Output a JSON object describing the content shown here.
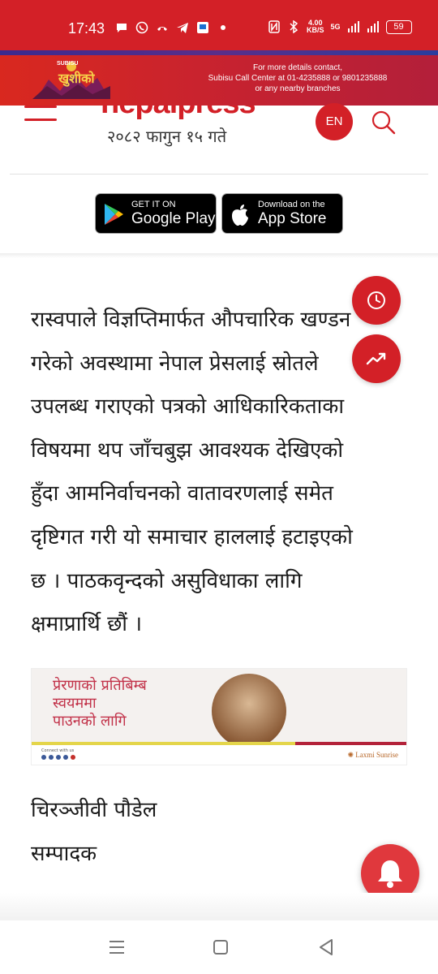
{
  "status_bar": {
    "time": "17:43",
    "net_speed": "4.00",
    "net_unit": "KB/S",
    "network_type": "5G",
    "battery": "59"
  },
  "top_ad": {
    "logo_text": "खुशीको",
    "logo_brand": "SUBISU",
    "line1": "For more details contact,",
    "line2": "Subisu Call Center at 01-4235888 or 9801235888",
    "line3": "or any nearby branches"
  },
  "header": {
    "site_logo": "nepalpress",
    "date": "२०८२ फागुन १५ गते",
    "lang_button": "EN"
  },
  "app_badges": {
    "google_small": "GET IT ON",
    "google_big": "Google Play",
    "apple_small": "Download on the",
    "apple_big": "App Store"
  },
  "article": {
    "lines": [
      "रास्वपाले विज्ञप्तिमार्फत औपचारिक खण्डन",
      "गरेको अवस्थामा नेपाल प्रेसलाई स्रोतले",
      "उपलब्ध गराएको पत्रको आधिकारिकताका",
      "विषयमा थप जाँचबुझ आवश्यक देखिएको",
      "हुँदा आमनिर्वाचनको वातावरणलाई समेत",
      "दृष्टिगत गरी यो समाचार हाललाई हटाइएको",
      "छ । पाठकवृन्दको असुविधाका लागि",
      "क्षमाप्रार्थि छौं ।"
    ]
  },
  "mid_ad": {
    "line1": "प्रेरणाको प्रतिबिम्ब",
    "line2": "स्वयममा",
    "line3": "पाउनको लागि",
    "contact": "Connect with us",
    "brand": "Laxmi Sunrise"
  },
  "signature": {
    "name": "चिरञ्जीवी पौडेल",
    "title": "सम्पादक"
  },
  "colors": {
    "brand_red": "#d32027",
    "bell_red": "#e0383d"
  },
  "icons": {
    "menu": "hamburger-icon",
    "search": "search-icon",
    "history": "clock-icon",
    "trending": "trending-up-icon",
    "notify": "bell-icon"
  }
}
